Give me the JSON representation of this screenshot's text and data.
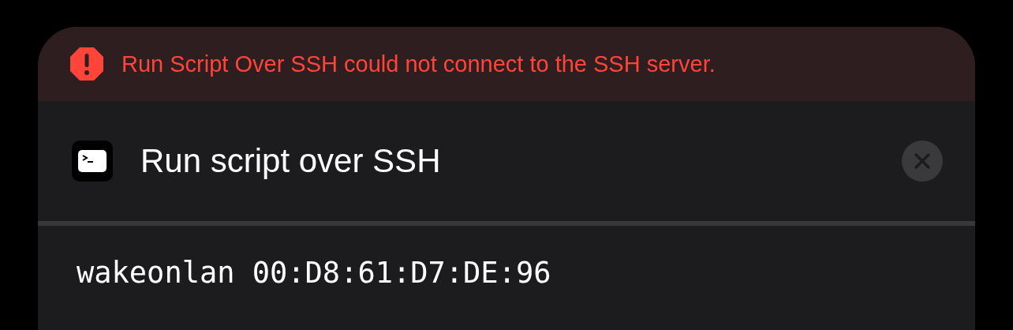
{
  "error_banner": {
    "message": "Run Script Over SSH could not connect to the SSH server."
  },
  "action": {
    "title": "Run script over SSH"
  },
  "script": {
    "value": "wakeonlan 00:D8:61:D7:DE:96"
  }
}
